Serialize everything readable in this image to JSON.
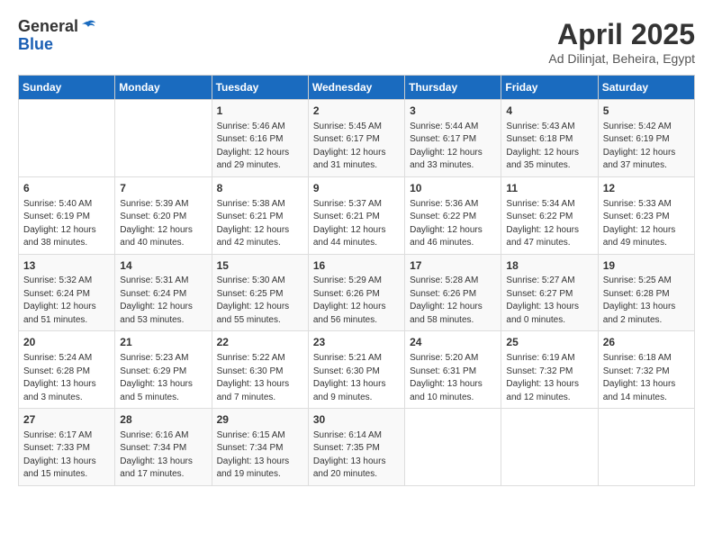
{
  "header": {
    "logo_general": "General",
    "logo_blue": "Blue",
    "month_title": "April 2025",
    "location": "Ad Dilinjat, Beheira, Egypt"
  },
  "days_of_week": [
    "Sunday",
    "Monday",
    "Tuesday",
    "Wednesday",
    "Thursday",
    "Friday",
    "Saturday"
  ],
  "weeks": [
    [
      {
        "day": "",
        "info": ""
      },
      {
        "day": "",
        "info": ""
      },
      {
        "day": "1",
        "info": "Sunrise: 5:46 AM\nSunset: 6:16 PM\nDaylight: 12 hours\nand 29 minutes."
      },
      {
        "day": "2",
        "info": "Sunrise: 5:45 AM\nSunset: 6:17 PM\nDaylight: 12 hours\nand 31 minutes."
      },
      {
        "day": "3",
        "info": "Sunrise: 5:44 AM\nSunset: 6:17 PM\nDaylight: 12 hours\nand 33 minutes."
      },
      {
        "day": "4",
        "info": "Sunrise: 5:43 AM\nSunset: 6:18 PM\nDaylight: 12 hours\nand 35 minutes."
      },
      {
        "day": "5",
        "info": "Sunrise: 5:42 AM\nSunset: 6:19 PM\nDaylight: 12 hours\nand 37 minutes."
      }
    ],
    [
      {
        "day": "6",
        "info": "Sunrise: 5:40 AM\nSunset: 6:19 PM\nDaylight: 12 hours\nand 38 minutes."
      },
      {
        "day": "7",
        "info": "Sunrise: 5:39 AM\nSunset: 6:20 PM\nDaylight: 12 hours\nand 40 minutes."
      },
      {
        "day": "8",
        "info": "Sunrise: 5:38 AM\nSunset: 6:21 PM\nDaylight: 12 hours\nand 42 minutes."
      },
      {
        "day": "9",
        "info": "Sunrise: 5:37 AM\nSunset: 6:21 PM\nDaylight: 12 hours\nand 44 minutes."
      },
      {
        "day": "10",
        "info": "Sunrise: 5:36 AM\nSunset: 6:22 PM\nDaylight: 12 hours\nand 46 minutes."
      },
      {
        "day": "11",
        "info": "Sunrise: 5:34 AM\nSunset: 6:22 PM\nDaylight: 12 hours\nand 47 minutes."
      },
      {
        "day": "12",
        "info": "Sunrise: 5:33 AM\nSunset: 6:23 PM\nDaylight: 12 hours\nand 49 minutes."
      }
    ],
    [
      {
        "day": "13",
        "info": "Sunrise: 5:32 AM\nSunset: 6:24 PM\nDaylight: 12 hours\nand 51 minutes."
      },
      {
        "day": "14",
        "info": "Sunrise: 5:31 AM\nSunset: 6:24 PM\nDaylight: 12 hours\nand 53 minutes."
      },
      {
        "day": "15",
        "info": "Sunrise: 5:30 AM\nSunset: 6:25 PM\nDaylight: 12 hours\nand 55 minutes."
      },
      {
        "day": "16",
        "info": "Sunrise: 5:29 AM\nSunset: 6:26 PM\nDaylight: 12 hours\nand 56 minutes."
      },
      {
        "day": "17",
        "info": "Sunrise: 5:28 AM\nSunset: 6:26 PM\nDaylight: 12 hours\nand 58 minutes."
      },
      {
        "day": "18",
        "info": "Sunrise: 5:27 AM\nSunset: 6:27 PM\nDaylight: 13 hours\nand 0 minutes."
      },
      {
        "day": "19",
        "info": "Sunrise: 5:25 AM\nSunset: 6:28 PM\nDaylight: 13 hours\nand 2 minutes."
      }
    ],
    [
      {
        "day": "20",
        "info": "Sunrise: 5:24 AM\nSunset: 6:28 PM\nDaylight: 13 hours\nand 3 minutes."
      },
      {
        "day": "21",
        "info": "Sunrise: 5:23 AM\nSunset: 6:29 PM\nDaylight: 13 hours\nand 5 minutes."
      },
      {
        "day": "22",
        "info": "Sunrise: 5:22 AM\nSunset: 6:30 PM\nDaylight: 13 hours\nand 7 minutes."
      },
      {
        "day": "23",
        "info": "Sunrise: 5:21 AM\nSunset: 6:30 PM\nDaylight: 13 hours\nand 9 minutes."
      },
      {
        "day": "24",
        "info": "Sunrise: 5:20 AM\nSunset: 6:31 PM\nDaylight: 13 hours\nand 10 minutes."
      },
      {
        "day": "25",
        "info": "Sunrise: 6:19 AM\nSunset: 7:32 PM\nDaylight: 13 hours\nand 12 minutes."
      },
      {
        "day": "26",
        "info": "Sunrise: 6:18 AM\nSunset: 7:32 PM\nDaylight: 13 hours\nand 14 minutes."
      }
    ],
    [
      {
        "day": "27",
        "info": "Sunrise: 6:17 AM\nSunset: 7:33 PM\nDaylight: 13 hours\nand 15 minutes."
      },
      {
        "day": "28",
        "info": "Sunrise: 6:16 AM\nSunset: 7:34 PM\nDaylight: 13 hours\nand 17 minutes."
      },
      {
        "day": "29",
        "info": "Sunrise: 6:15 AM\nSunset: 7:34 PM\nDaylight: 13 hours\nand 19 minutes."
      },
      {
        "day": "30",
        "info": "Sunrise: 6:14 AM\nSunset: 7:35 PM\nDaylight: 13 hours\nand 20 minutes."
      },
      {
        "day": "",
        "info": ""
      },
      {
        "day": "",
        "info": ""
      },
      {
        "day": "",
        "info": ""
      }
    ]
  ]
}
